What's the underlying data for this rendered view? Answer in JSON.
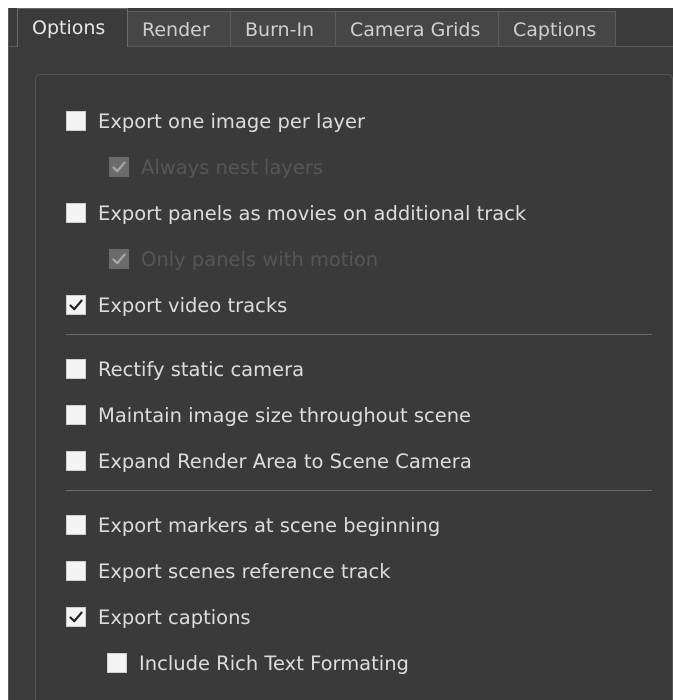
{
  "tabs": [
    {
      "label": "Options",
      "active": true
    },
    {
      "label": "Render",
      "active": false
    },
    {
      "label": "Burn-In",
      "active": false
    },
    {
      "label": "Camera Grids",
      "active": false
    },
    {
      "label": "Captions",
      "active": false
    }
  ],
  "options": {
    "export_one_image_per_layer": {
      "label": "Export one image per layer",
      "checked": false
    },
    "always_nest_layers": {
      "label": "Always nest layers",
      "checked": true,
      "enabled": false
    },
    "export_panels_as_movies": {
      "label": "Export panels as movies on additional track",
      "checked": false
    },
    "only_panels_with_motion": {
      "label": "Only panels with motion",
      "checked": true,
      "enabled": false
    },
    "export_video_tracks": {
      "label": "Export video tracks",
      "checked": true
    },
    "rectify_static_camera": {
      "label": "Rectify static camera",
      "checked": false
    },
    "maintain_image_size": {
      "label": "Maintain image size throughout scene",
      "checked": false
    },
    "expand_render_area": {
      "label": "Expand Render Area to Scene Camera",
      "checked": false
    },
    "export_markers": {
      "label": "Export markers at scene beginning",
      "checked": false
    },
    "export_scenes_reference": {
      "label": "Export scenes reference track",
      "checked": false
    },
    "export_captions": {
      "label": "Export captions",
      "checked": true
    },
    "include_rich_text": {
      "label": "Include Rich Text Formating",
      "checked": false
    }
  },
  "colors": {
    "background": "#3b3b3b",
    "text": "#dcdcdc",
    "disabled_text": "#565656",
    "checkbox": "#f4f4f4"
  }
}
